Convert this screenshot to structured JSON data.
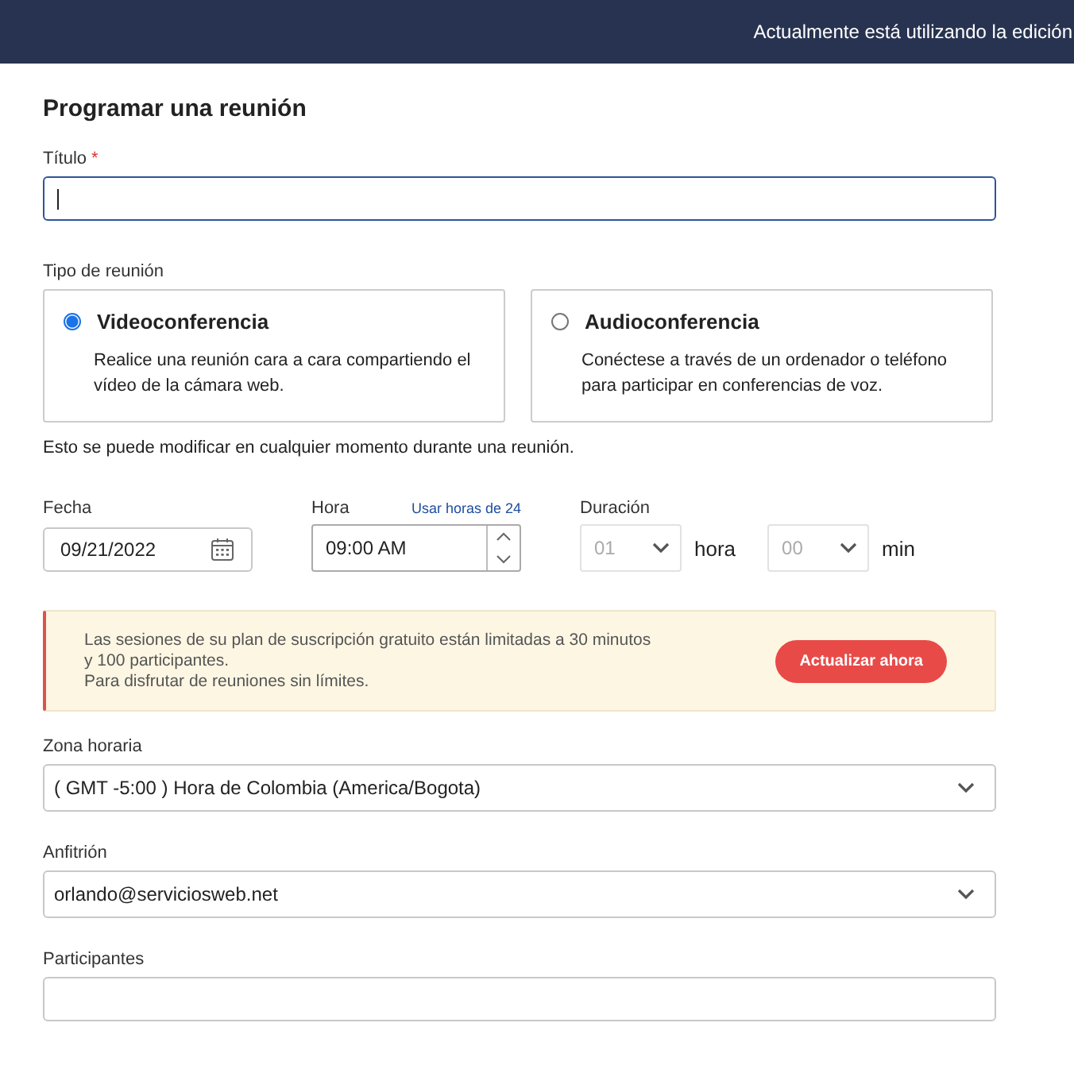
{
  "top_bar": {
    "text": "Actualmente está utilizando la edición"
  },
  "heading": "Programar una reunión",
  "title_field": {
    "label": "Título",
    "required_mark": "*",
    "focused": true
  },
  "meeting_type": {
    "label": "Tipo de reunión",
    "options": [
      {
        "title": "Videoconferencia",
        "description": "Realice una reunión cara a cara compartiendo el vídeo de la cámara web.",
        "selected": true
      },
      {
        "title": "Audioconferencia",
        "description": "Conéctese a través de un ordenador o teléfono para participar en conferencias de voz.",
        "selected": false
      }
    ],
    "note": "Esto se puede modificar en cualquier momento durante una reunión."
  },
  "date": {
    "label": "Fecha",
    "value": "09/21/2022"
  },
  "time": {
    "label": "Hora",
    "link": "Usar horas de 24",
    "value": "09:00 AM"
  },
  "duration": {
    "label": "Duración",
    "hours": {
      "value": "01",
      "unit": "hora",
      "disabled": true
    },
    "minutes": {
      "value": "00",
      "unit": "min",
      "disabled": true
    }
  },
  "notice": {
    "lines": [
      "Las sesiones de su plan de suscripción gratuito están limitadas a 30 minutos",
      "y 100 participantes.",
      "Para disfrutar de reuniones sin límites."
    ],
    "button": "Actualizar ahora"
  },
  "timezone": {
    "label": "Zona horaria",
    "value": "( GMT -5:00 ) Hora de Colombia (America/Bogota)"
  },
  "host": {
    "label": "Anfitrión",
    "value": "orlando@serviciosweb.net"
  },
  "participants": {
    "label": "Participantes"
  }
}
